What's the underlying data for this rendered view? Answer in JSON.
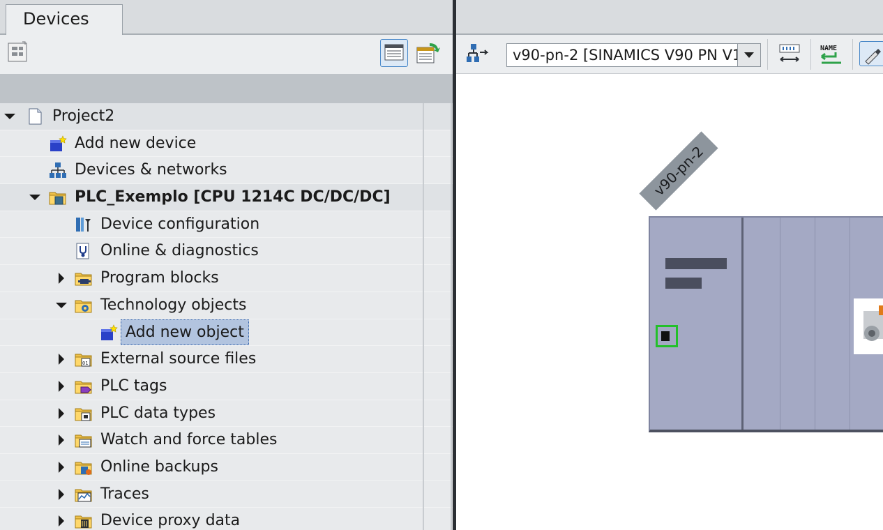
{
  "left_pane": {
    "tab_title": "Devices",
    "tree": [
      {
        "label": "Project2",
        "level": 0,
        "expander": "expanded",
        "icon": "project-icon",
        "bold": false
      },
      {
        "label": "Add new device",
        "level": 1,
        "expander": "none",
        "icon": "add-device-icon",
        "bold": false
      },
      {
        "label": "Devices & networks",
        "level": 1,
        "expander": "none",
        "icon": "network-icon",
        "bold": false
      },
      {
        "label": "PLC_Exemplo [CPU 1214C DC/DC/DC]",
        "level": 1,
        "expander": "expanded",
        "icon": "plc-folder-icon",
        "bold": true
      },
      {
        "label": "Device configuration",
        "level": 2,
        "expander": "none",
        "icon": "device-config-icon",
        "bold": false
      },
      {
        "label": "Online & diagnostics",
        "level": 2,
        "expander": "none",
        "icon": "diagnostics-icon",
        "bold": false
      },
      {
        "label": "Program blocks",
        "level": 2,
        "expander": "collapsed",
        "icon": "program-blocks-icon",
        "bold": false
      },
      {
        "label": "Technology objects",
        "level": 2,
        "expander": "expanded",
        "icon": "technology-objects-icon",
        "bold": false
      },
      {
        "label": "Add new object",
        "level": 3,
        "expander": "none",
        "icon": "add-object-icon",
        "bold": false,
        "selected": true
      },
      {
        "label": "External source files",
        "level": 2,
        "expander": "collapsed",
        "icon": "external-source-icon",
        "bold": false
      },
      {
        "label": "PLC tags",
        "level": 2,
        "expander": "collapsed",
        "icon": "plc-tags-icon",
        "bold": false
      },
      {
        "label": "PLC data types",
        "level": 2,
        "expander": "collapsed",
        "icon": "plc-data-types-icon",
        "bold": false
      },
      {
        "label": "Watch and force tables",
        "level": 2,
        "expander": "collapsed",
        "icon": "watch-tables-icon",
        "bold": false
      },
      {
        "label": "Online backups",
        "level": 2,
        "expander": "collapsed",
        "icon": "online-backups-icon",
        "bold": false
      },
      {
        "label": "Traces",
        "level": 2,
        "expander": "collapsed",
        "icon": "traces-icon",
        "bold": false
      },
      {
        "label": "Device proxy data",
        "level": 2,
        "expander": "collapsed",
        "icon": "device-proxy-icon",
        "bold": false
      }
    ]
  },
  "right_pane": {
    "device_select_value": "v90-pn-2 [SINAMICS V90 PN V1",
    "device_label": "v90-pn-2",
    "name_button_text": "NAME"
  },
  "colors": {
    "selection": "#b2c4df",
    "rack": "#a4a9c4",
    "port_active": "#22c02a"
  }
}
